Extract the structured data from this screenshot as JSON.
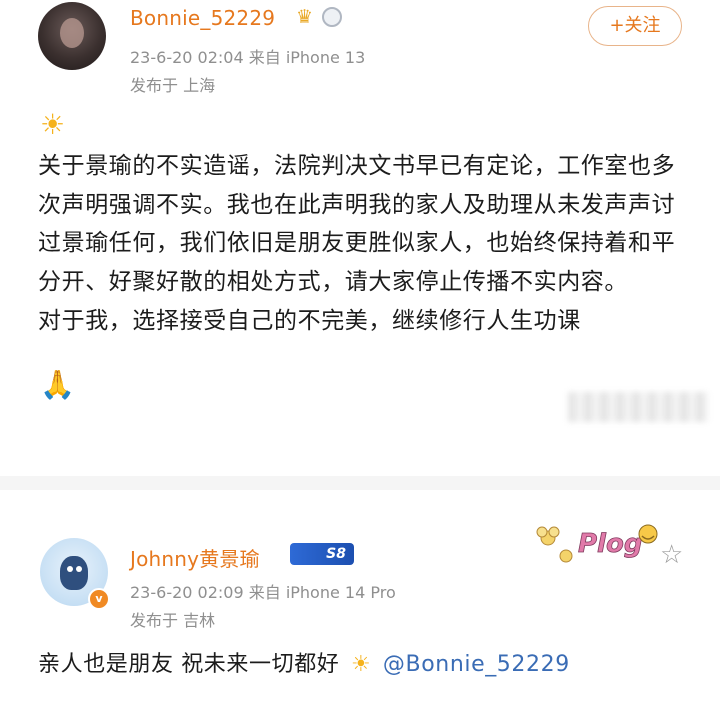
{
  "post1": {
    "username": "Bonnie_52229",
    "timestamp": "23-6-20 02:04",
    "source": "来自 iPhone 13",
    "location": "发布于 上海",
    "follow_label": "+关注",
    "body_lines": [
      "关于景瑜的不实造谣，法院判决文书早已有定论，工作室也多次声明强调不实。我也在此声明我的家人及助理从未发声声讨过景瑜任何，我们依旧是朋友更胜似家人，也始终保持着和平分开、好聚好散的相处方式，请大家停止传播不实内容。",
      "对于我，选择接受自己的不完美，继续修行人生功课"
    ],
    "icons": [
      "sun-emoji",
      "folded-hands-emoji",
      "crown-badge",
      "medal-badge"
    ]
  },
  "post2": {
    "username": "Johnny黄景瑜",
    "level_badge": "S8",
    "timestamp": "23-6-20 02:09",
    "source": "来自 iPhone 14 Pro",
    "location": "发布于 吉林",
    "reply_text": "亲人也是朋友 祝未来一切都好",
    "mention": "@Bonnie_52229",
    "verified_badge": "v",
    "sticker_text": "Plog",
    "icons": [
      "sun-emoji",
      "star-icon",
      "verified-badge"
    ]
  },
  "colors": {
    "username": "#e6781e",
    "meta": "#8f8f8f",
    "mention": "#3a6cb5",
    "badge_blue": "#2e6ad6"
  }
}
